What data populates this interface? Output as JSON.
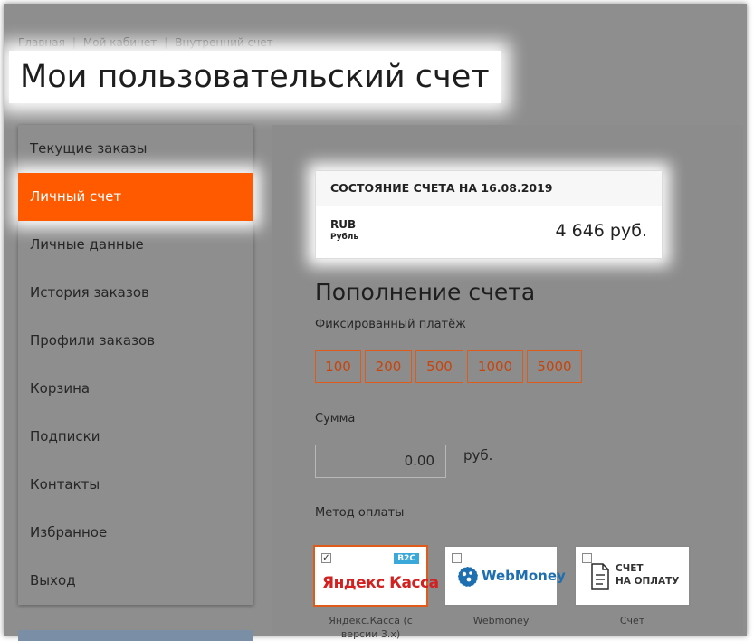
{
  "breadcrumb": {
    "items": [
      "Главная",
      "Мой кабинет",
      "Внутренний счет"
    ],
    "separator": "|"
  },
  "page_title": "Мои пользовательский счет",
  "sidebar": {
    "items": [
      {
        "label": "Текущие заказы"
      },
      {
        "label": "Личный счет",
        "active": true
      },
      {
        "label": "Личные данные"
      },
      {
        "label": "История заказов"
      },
      {
        "label": "Профили заказов"
      },
      {
        "label": "Корзина"
      },
      {
        "label": "Подписки"
      },
      {
        "label": "Контакты"
      },
      {
        "label": "Избранное"
      },
      {
        "label": "Выход"
      }
    ]
  },
  "balance": {
    "header": "СОСТОЯНИЕ СЧЕТА НА 16.08.2019",
    "currency_code": "RUB",
    "currency_name": "Рубль",
    "amount": "4 646 руб."
  },
  "topup": {
    "title": "Пополнение счета",
    "fixed_label": "Фиксированный платёж",
    "fixed_amounts": [
      "100",
      "200",
      "500",
      "1000",
      "5000"
    ],
    "sum_label": "Сумма",
    "sum_value": "0.00",
    "sum_unit": "руб.",
    "method_label": "Метод оплаты",
    "methods": [
      {
        "caption": "Яндекс.Касса (с версии 3.х)",
        "logo_text": "Яндекс Касса",
        "badge": "B2C",
        "checked": true
      },
      {
        "caption": "Webmoney",
        "logo_text": "WebMoney",
        "checked": false
      },
      {
        "caption": "Счет",
        "logo_text_line1": "СЧЕТ",
        "logo_text_line2": "НА ОПЛАТУ",
        "checked": false
      }
    ]
  },
  "colors": {
    "accent": "#ff5a00",
    "accent_border": "#e05a1a",
    "dim_overlay": "#8e8e8e",
    "webmoney_blue": "#1e6fb0",
    "yandex_red": "#d32020"
  }
}
